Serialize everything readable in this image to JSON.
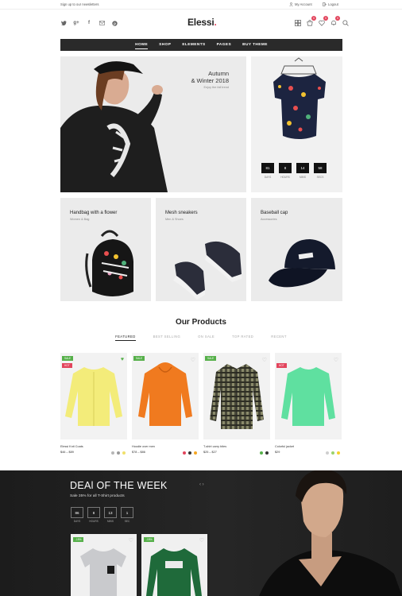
{
  "topbar": {
    "newsletter": "Sign up to our newsletters",
    "account": "My Account",
    "logout": "Logout"
  },
  "social": [
    "twitter-icon",
    "google-plus-icon",
    "facebook-icon",
    "mail-icon",
    "pinterest-icon"
  ],
  "logo": {
    "text": "Elessi",
    "dot": "."
  },
  "header_icons": {
    "compare_icon": "compare-icon",
    "cart_count": "0",
    "wishlist_count": "0",
    "notify_count": "0",
    "search_icon": "search-icon"
  },
  "nav": [
    "HOME",
    "SHOP",
    "ELEMENTS",
    "PAGES",
    "BUY THEME"
  ],
  "hero": {
    "title_line1": "Autumn",
    "title_line2": "& Winter 2018",
    "subtitle": "Enjoy the fall trend"
  },
  "countdown": [
    {
      "value": "81",
      "label": "DAYS"
    },
    {
      "value": "8",
      "label": "HOURS"
    },
    {
      "value": "14",
      "label": "MINS"
    },
    {
      "value": "58",
      "label": "SECS"
    }
  ],
  "categories": [
    {
      "title": "Handbag with a flower",
      "subtitle": "Women & Bag"
    },
    {
      "title": "Mesh sneakers",
      "subtitle": "Men & Shoes"
    },
    {
      "title": "Baseball cap",
      "subtitle": "Accessories"
    }
  ],
  "products": {
    "title": "Our Products",
    "tabs": [
      "FEATURED",
      "BEST SELLING",
      "ON SALE",
      "TOP RATED",
      "RECENT"
    ],
    "items": [
      {
        "name": "Elessi Knit Coats",
        "price": "$46 – $89",
        "tags": [
          "SALE",
          "HOT"
        ],
        "tag_colors": [
          "#56b04a",
          "#e2445c"
        ],
        "swatches": [
          "#b7b7b7",
          "#9a9a9a",
          "#f0e06a"
        ]
      },
      {
        "name": "Hoodie over men",
        "price": "$78 – $86",
        "tags": [
          "SALE"
        ],
        "tag_colors": [
          "#56b04a"
        ],
        "swatches": [
          "#e2445c",
          "#333333",
          "#f5a623"
        ]
      },
      {
        "name": "T-shirt carry bites",
        "price": "$25 – $27",
        "tags": [
          "SALE"
        ],
        "tag_colors": [
          "#56b04a"
        ],
        "swatches": [
          "#56b04a",
          "#333333"
        ]
      },
      {
        "name": "Colorful jacket",
        "price": "$29",
        "tags": [
          "HOT"
        ],
        "tag_colors": [
          "#e2445c"
        ],
        "swatches": [
          "#cfcfcf",
          "#9bd36b",
          "#f5d12a"
        ]
      }
    ]
  },
  "deal": {
    "title": "DEAl OF THE WEEK",
    "subtitle": "Sale 35% for all T-Shirt products",
    "arrows": "‹  ›",
    "countdown": [
      {
        "value": "86",
        "label": "DAYS"
      },
      {
        "value": "8",
        "label": "HOURS"
      },
      {
        "value": "13",
        "label": "MINS"
      },
      {
        "value": "1",
        "label": "SEC"
      }
    ],
    "cards": [
      {
        "tag": "-15%"
      },
      {
        "tag": "-15%"
      }
    ]
  }
}
